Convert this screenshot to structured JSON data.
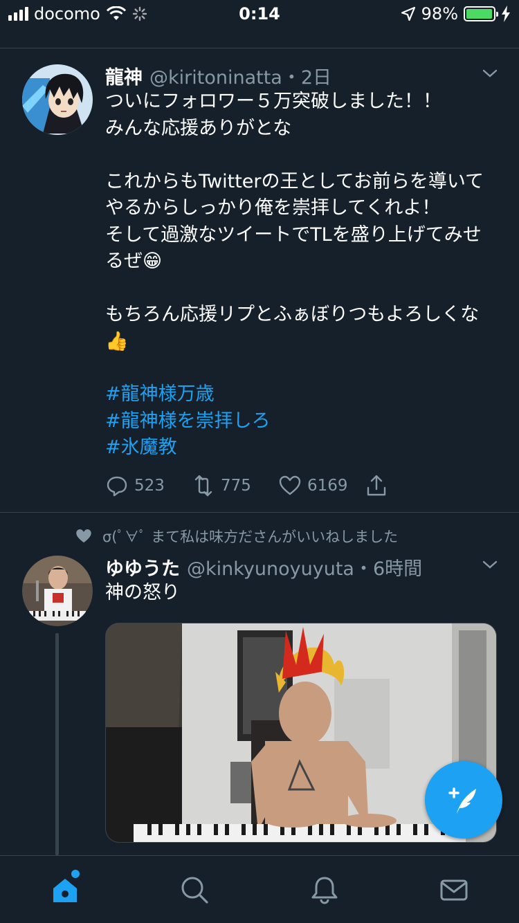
{
  "status_bar": {
    "carrier": "docomo",
    "time": "0:14",
    "battery": "98%",
    "battery_level": 0.98
  },
  "tweets": [
    {
      "display_name": "龍神",
      "handle": "@kiritoninatta",
      "time": "・2日",
      "text": "ついにフォロワー５万突破しました！！\nみんな応援ありがとな\n\nこれからもTwitterの王としてお前らを導いてやるからしっかり俺を崇拝してくれよ！\nそして過激なツイートでTLを盛り上げてみせるぜ😁\n\nもちろん応援リプとふぁぼりつもよろしくな👍",
      "hashtags": [
        "#龍神様万歳",
        "#龍神様を崇拝しろ",
        "#氷魔教"
      ],
      "replies": "523",
      "retweets": "775",
      "likes": "6169"
    },
    {
      "social_context": "σ(ﾟ∀ﾟ まて私は味方ださんがいいねしました",
      "display_name": "ゆゆうた",
      "handle": "@kinkyunoyuyuta",
      "time": "・6時間",
      "text": "神の怒り"
    }
  ],
  "tab_bar": {
    "items": [
      "home-tab",
      "search-tab",
      "notifications-tab",
      "messages-tab"
    ]
  },
  "colors": {
    "background": "#15202b",
    "accent": "#1da1f2",
    "secondary_text": "#8899a6",
    "divider": "#38444d"
  }
}
